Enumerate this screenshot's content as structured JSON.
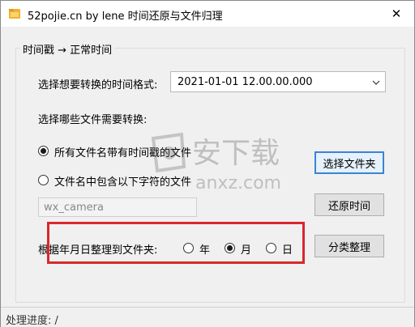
{
  "window": {
    "title": "52pojie.cn by lene 时间还原与文件归理",
    "close_glyph": "✕"
  },
  "group": {
    "title": "时间戳 → 正常时间"
  },
  "format": {
    "label": "选择想要转换的时间格式:",
    "selected": "2021-01-01 12.00.00.000"
  },
  "files": {
    "label": "选择哪些文件需要转换:",
    "option_all": "所有文件名带有时间戳的文件",
    "option_contains": "文件名中包含以下字符的文件",
    "filter_value": "wx_camera"
  },
  "organize": {
    "label": "根据年月日整理到文件夹:",
    "year": "年",
    "month": "月",
    "day": "日"
  },
  "buttons": {
    "select_folder": "选择文件夹",
    "restore_time": "还原时间",
    "classify": "分类整理"
  },
  "status": {
    "text": "处理进度: /"
  },
  "watermark": {
    "text": "安下载",
    "domain": "anxz.com"
  },
  "colors": {
    "highlight_border": "#d9272e",
    "default_button_border": "#3a84d6"
  }
}
